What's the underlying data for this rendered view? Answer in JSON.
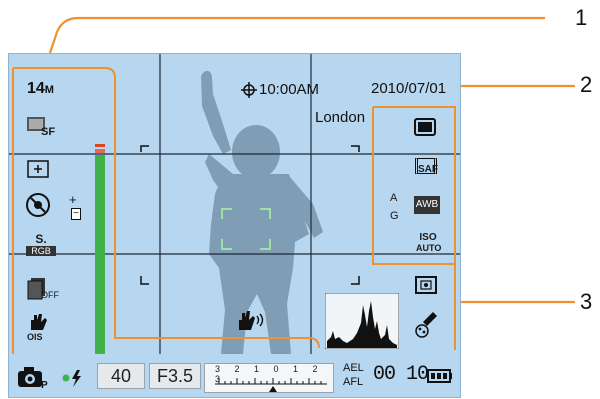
{
  "callouts": {
    "one": "1",
    "two": "2",
    "three": "3"
  },
  "left_panel": {
    "resolution": "14",
    "resolution_unit": "M",
    "quality_sub": "SF",
    "color_mode_top": "S.",
    "color_mode_bottom": "RGB",
    "burst_sub": "OFF",
    "ois_label": "OIS"
  },
  "top_info": {
    "time": "10:00",
    "ampm": "AM",
    "date": "2010/07/01",
    "city": "London"
  },
  "right_panel": {
    "autofocus_label": "SAF",
    "wb_adjust_a": "A",
    "wb_adjust_g": "G",
    "white_balance": "AWB",
    "iso_top": "ISO",
    "iso_bottom": "AUTO"
  },
  "exposure": {
    "plus": "+",
    "minus": "−"
  },
  "bottom_bar": {
    "shots": "40",
    "aperture": "F3.5",
    "scale_top": "3 2 1 0 1 2 3",
    "ael": "AEL",
    "afl": "AFL",
    "time_remaining": "00 10"
  }
}
